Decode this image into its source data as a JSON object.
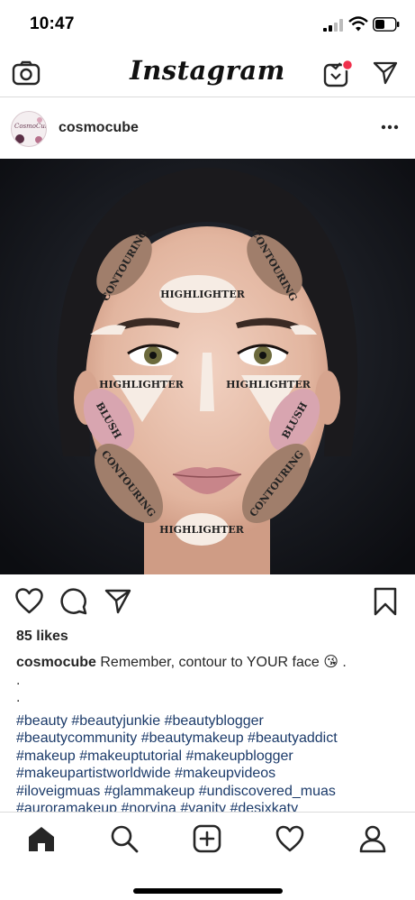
{
  "status_bar": {
    "time": "10:47"
  },
  "header": {
    "logo_text": "Instagram",
    "camera_icon": "camera-icon",
    "igtv_icon": "igtv-icon",
    "direct_icon": "paper-plane-icon",
    "notification_dot_color": "#f0304c"
  },
  "post": {
    "avatar_text": "CosmoCube",
    "username": "cosmocube",
    "more_icon": "more-dots-icon",
    "image_labels": {
      "contouring": "CONTOURING",
      "highlighter": "HIGHLIGHTER",
      "blush": "BLUSH"
    },
    "likes": "85 likes",
    "caption": {
      "username": "cosmocube",
      "text": "Remember, contour to YOUR face",
      "emoji": "😘",
      "trailing": " .",
      "dots": [
        ".",
        "."
      ],
      "hashtag_lines": [
        "#beauty #beautyjunkie #beautyblogger",
        "#beautycommunity #beautymakeup #beautyaddict",
        "#makeup #makeuptutorial #makeupblogger",
        "#makeupartistworldwide  #makeupvideos",
        "#iloveigmuas #glammakeup #undiscovered_muas",
        "#auroramakeup #norvina #vanity #desixkaty"
      ]
    }
  },
  "bottom_nav": {
    "items": [
      "home-icon",
      "search-icon",
      "add-post-icon",
      "heart-icon",
      "profile-icon"
    ]
  },
  "colors": {
    "text": "#262626",
    "hashtag": "#1c3b6a",
    "divider": "#dbdbdb",
    "contour": "#a07e6b",
    "highlight": "#f6ece4",
    "blush": "#d8a5b0"
  }
}
